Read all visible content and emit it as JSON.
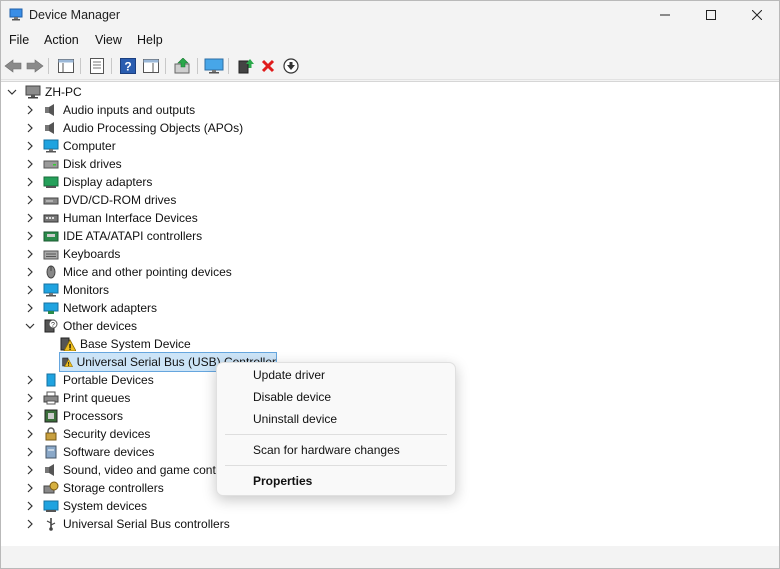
{
  "window": {
    "title": "Device Manager"
  },
  "menu": [
    "File",
    "Action",
    "View",
    "Help"
  ],
  "tree": {
    "root": "ZH-PC",
    "items": [
      {
        "label": "Audio inputs and outputs",
        "icon": "speaker-icon"
      },
      {
        "label": "Audio Processing Objects (APOs)",
        "icon": "speaker-icon"
      },
      {
        "label": "Computer",
        "icon": "computer-icon"
      },
      {
        "label": "Disk drives",
        "icon": "disk-drive-icon"
      },
      {
        "label": "Display adapters",
        "icon": "display-adapter-icon"
      },
      {
        "label": "DVD/CD-ROM drives",
        "icon": "dvd-drive-icon"
      },
      {
        "label": "Human Interface Devices",
        "icon": "hid-icon"
      },
      {
        "label": "IDE ATA/ATAPI controllers",
        "icon": "ide-controller-icon"
      },
      {
        "label": "Keyboards",
        "icon": "keyboard-icon"
      },
      {
        "label": "Mice and other pointing devices",
        "icon": "mouse-icon"
      },
      {
        "label": "Monitors",
        "icon": "monitor-icon"
      },
      {
        "label": "Network adapters",
        "icon": "network-adapter-icon"
      },
      {
        "label": "Other devices",
        "icon": "unknown-device-icon",
        "expanded": true
      },
      {
        "label": "Portable Devices",
        "icon": "portable-device-icon"
      },
      {
        "label": "Print queues",
        "icon": "printer-icon"
      },
      {
        "label": "Processors",
        "icon": "processor-icon"
      },
      {
        "label": "Security devices",
        "icon": "security-device-icon"
      },
      {
        "label": "Software devices",
        "icon": "software-device-icon"
      },
      {
        "label": "Sound, video and game controllers",
        "icon": "speaker-icon"
      },
      {
        "label": "Storage controllers",
        "icon": "storage-controller-icon"
      },
      {
        "label": "System devices",
        "icon": "system-device-icon"
      },
      {
        "label": "Universal Serial Bus controllers",
        "icon": "usb-icon"
      }
    ],
    "other_children": [
      {
        "label": "Base System Device",
        "icon": "warning-device-icon"
      },
      {
        "label": "Universal Serial Bus (USB) Controller",
        "icon": "warning-device-icon",
        "selected": true
      }
    ]
  },
  "context_menu": {
    "update": "Update driver",
    "disable": "Disable device",
    "uninstall": "Uninstall device",
    "scan": "Scan for hardware changes",
    "properties": "Properties"
  },
  "colors": {
    "selection": "#cce4f7",
    "accent": "#0067c0"
  }
}
